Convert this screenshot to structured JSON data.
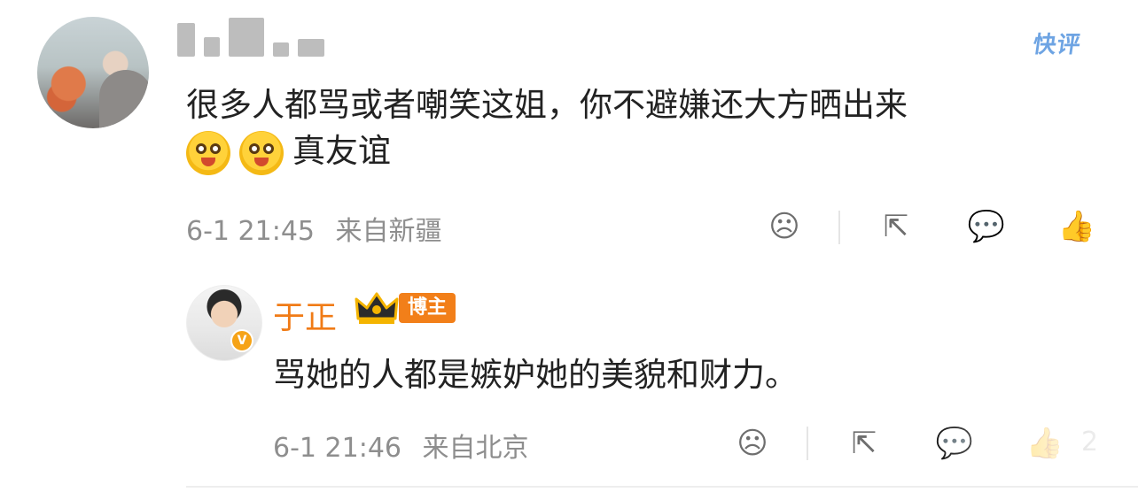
{
  "top_right": {
    "label": "快评"
  },
  "comments": [
    {
      "text": "很多人都骂或者嘲笑这姐，你不避嫌还大方晒出来",
      "text_line2": "真友谊",
      "time": "6-1 21:45",
      "location": "来自新疆",
      "emoji": "laughing-emoji"
    },
    {
      "username": "于正",
      "badge": "博主",
      "text": "骂她的人都是嫉妒她的美貌和财力。",
      "time": "6-1 21:46",
      "location": "来自北京",
      "like_count": "2"
    }
  ],
  "icons": {
    "sad_face": "☹",
    "share": "⇱",
    "comment": "💬",
    "like": "👍"
  }
}
